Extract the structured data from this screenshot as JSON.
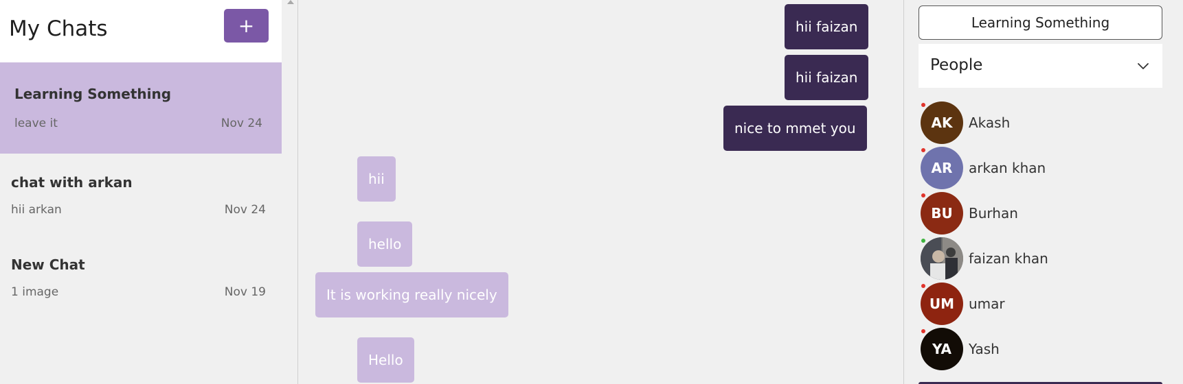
{
  "sidebar": {
    "title": "My Chats",
    "new_chat_label": "+",
    "chats": [
      {
        "name": "Learning Something",
        "last_message": "leave it",
        "date": "Nov 24",
        "active": true
      },
      {
        "name": "chat with arkan",
        "last_message": "hii arkan",
        "date": "Nov 24",
        "active": false
      },
      {
        "name": "New Chat",
        "last_message": "1 image",
        "date": "Nov 19",
        "active": false
      }
    ]
  },
  "messages": [
    {
      "text": "hii faizan",
      "direction": "sent"
    },
    {
      "text": "hii faizan",
      "direction": "sent"
    },
    {
      "text": "nice to mmet you",
      "direction": "sent"
    },
    {
      "text": "hii",
      "direction": "received"
    },
    {
      "text": "hello",
      "direction": "received"
    },
    {
      "text": "It is working really nicely",
      "direction": "received"
    },
    {
      "text": "Hello",
      "direction": "received"
    }
  ],
  "right_panel": {
    "group_name": "Learning Something",
    "people_label": "People",
    "members": [
      {
        "initials": "AK",
        "name": "Akash",
        "avatar_color": "#5c3410",
        "status": "offline"
      },
      {
        "initials": "AR",
        "name": "arkan khan",
        "avatar_color": "#6f73ad",
        "status": "offline"
      },
      {
        "initials": "BU",
        "name": "Burhan",
        "avatar_color": "#8b2a13",
        "status": "offline"
      },
      {
        "initials": "",
        "name": "faizan khan",
        "avatar_color": "#6b6b6b",
        "status": "online"
      },
      {
        "initials": "UM",
        "name": "umar",
        "avatar_color": "#8e2410",
        "status": "offline"
      },
      {
        "initials": "YA",
        "name": "Yash",
        "avatar_color": "#120c06",
        "status": "offline"
      }
    ]
  },
  "colors": {
    "accent": "#7b58a6",
    "sent_bubble": "#3a2a52",
    "received_bubble": "#cab9de",
    "status_offline": "#e0342c",
    "status_online": "#3fb43f"
  },
  "icons": {
    "new_chat": "plus-icon",
    "people_toggle": "chevron-down-icon",
    "scroll_up": "scroll-up-arrow-icon"
  }
}
